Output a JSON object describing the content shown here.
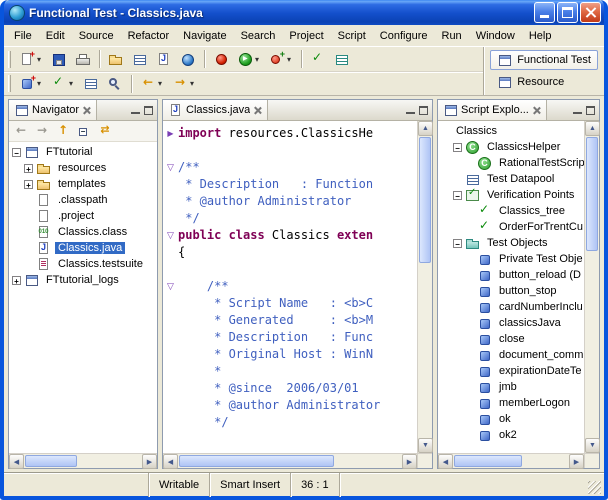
{
  "window": {
    "title": "Functional Test - Classics.java"
  },
  "menubar": {
    "items": [
      "File",
      "Edit",
      "Source",
      "Refactor",
      "Navigate",
      "Search",
      "Project",
      "Script",
      "Configure",
      "Run",
      "Window",
      "Help"
    ]
  },
  "toolbar": {
    "row1": [
      {
        "icon": "new-script-icon",
        "chevron": true
      },
      {
        "icon": "save-icon"
      },
      {
        "icon": "print-icon"
      },
      "sep",
      {
        "icon": "new-folder-icon"
      },
      {
        "icon": "new-datapool-icon"
      },
      {
        "icon": "new-java-icon"
      },
      {
        "icon": "globe-icon"
      },
      "sep",
      {
        "icon": "record-icon"
      },
      {
        "icon": "run-script-icon",
        "chevron": true
      },
      {
        "icon": "insert-recording-icon",
        "chevron": true
      },
      "sep",
      {
        "icon": "verification-point-icon"
      },
      {
        "icon": "object-map-icon"
      }
    ],
    "row2": [
      {
        "icon": "insert-object-icon",
        "chevron": true
      },
      {
        "icon": "insert-vp-icon",
        "chevron": true
      },
      {
        "icon": "datapool-icon"
      },
      {
        "icon": "find-object-icon"
      },
      "sep",
      {
        "icon": "back-icon",
        "chevron": true
      },
      {
        "icon": "forward-icon",
        "chevron": true
      }
    ],
    "perspectives": [
      {
        "label": "Functional Test",
        "selected": true
      },
      {
        "label": "Resource",
        "selected": false
      }
    ]
  },
  "navigator": {
    "title": "Navigator",
    "toolbar": [
      "back-icon",
      "forward-icon",
      "up-icon",
      "collapse-all-icon",
      "link-editor-icon"
    ],
    "tree": [
      {
        "label": "FTtutorial",
        "level": 0,
        "expander": "minus",
        "icon": "project-icon"
      },
      {
        "label": "resources",
        "level": 1,
        "expander": "plus",
        "icon": "folder-icon"
      },
      {
        "label": "templates",
        "level": 1,
        "expander": "plus",
        "icon": "folder-icon"
      },
      {
        "label": ".classpath",
        "level": 1,
        "icon": "file-icon"
      },
      {
        "label": ".project",
        "level": 1,
        "icon": "file-icon"
      },
      {
        "label": "Classics.class",
        "level": 1,
        "icon": "class-file-icon"
      },
      {
        "label": "Classics.java",
        "level": 1,
        "icon": "java-file-icon",
        "selected": true
      },
      {
        "label": "Classics.testsuite",
        "level": 1,
        "icon": "testsuite-icon"
      },
      {
        "label": "FTtutorial_logs",
        "level": 0,
        "expander": "plus",
        "icon": "project-icon"
      }
    ]
  },
  "editor": {
    "tab": "Classics.java",
    "lines": [
      {
        "fold": "closed",
        "segs": [
          {
            "c": "kw",
            "t": "import"
          },
          {
            "c": "pl",
            "t": " resources.ClassicsHe"
          }
        ]
      },
      {
        "segs": []
      },
      {
        "fold": "open",
        "segs": [
          {
            "c": "cm",
            "t": "/**"
          }
        ]
      },
      {
        "segs": [
          {
            "c": "cm",
            "t": " * Description   : Function"
          }
        ]
      },
      {
        "segs": [
          {
            "c": "cm",
            "t": " * @author Administrator"
          }
        ]
      },
      {
        "segs": [
          {
            "c": "cm",
            "t": " */"
          }
        ]
      },
      {
        "fold": "open",
        "segs": [
          {
            "c": "kw",
            "t": "public class"
          },
          {
            "c": "pl",
            "t": " Classics "
          },
          {
            "c": "kw",
            "t": "exten"
          }
        ]
      },
      {
        "segs": [
          {
            "c": "pl",
            "t": "{"
          }
        ]
      },
      {
        "segs": []
      },
      {
        "fold": "open",
        "segs": [
          {
            "c": "cm",
            "t": "    /**"
          }
        ]
      },
      {
        "segs": [
          {
            "c": "cm",
            "t": "     * Script Name   : <b>C"
          }
        ]
      },
      {
        "segs": [
          {
            "c": "cm",
            "t": "     * Generated     : <b>M"
          }
        ]
      },
      {
        "segs": [
          {
            "c": "cm",
            "t": "     * Description   : Func"
          }
        ]
      },
      {
        "segs": [
          {
            "c": "cm",
            "t": "     * Original Host : WinN"
          }
        ]
      },
      {
        "segs": [
          {
            "c": "cm",
            "t": "     *"
          }
        ]
      },
      {
        "segs": [
          {
            "c": "cm",
            "t": "     * @since  2006/03/01"
          }
        ]
      },
      {
        "segs": [
          {
            "c": "cm",
            "t": "     * @author Administrator"
          }
        ]
      },
      {
        "segs": [
          {
            "c": "cm",
            "t": "     */"
          }
        ]
      }
    ]
  },
  "script_explorer": {
    "title": "Script Explo...",
    "tree": [
      {
        "label": "Classics",
        "level": 0
      },
      {
        "label": "ClassicsHelper",
        "level": 1,
        "expander": "minus",
        "icon": "helper-icon"
      },
      {
        "label": "RationalTestScrip",
        "level": 2,
        "icon": "helper-icon"
      },
      {
        "label": "Test Datapool",
        "level": 1,
        "icon": "datapool-icon"
      },
      {
        "label": "Verification Points",
        "level": 1,
        "expander": "minus",
        "icon": "vp-folder-icon"
      },
      {
        "label": "Classics_tree",
        "level": 2,
        "icon": "vp-icon"
      },
      {
        "label": "OrderForTrentCu",
        "level": 2,
        "icon": "vp-icon"
      },
      {
        "label": "Test Objects",
        "level": 1,
        "expander": "minus",
        "icon": "to-folder-icon"
      },
      {
        "label": "Private Test Obje",
        "level": 2,
        "icon": "object-icon"
      },
      {
        "label": "button_reload (D",
        "level": 2,
        "icon": "object-icon"
      },
      {
        "label": "button_stop",
        "level": 2,
        "icon": "object-icon"
      },
      {
        "label": "cardNumberInclu",
        "level": 2,
        "icon": "object-icon"
      },
      {
        "label": "classicsJava",
        "level": 2,
        "icon": "object-icon"
      },
      {
        "label": "close",
        "level": 2,
        "icon": "object-icon"
      },
      {
        "label": "document_comm",
        "level": 2,
        "icon": "object-icon"
      },
      {
        "label": "expirationDateTe",
        "level": 2,
        "icon": "object-icon"
      },
      {
        "label": "jmb",
        "level": 2,
        "icon": "object-icon"
      },
      {
        "label": "memberLogon",
        "level": 2,
        "icon": "object-icon"
      },
      {
        "label": "ok",
        "level": 2,
        "icon": "object-icon"
      },
      {
        "label": "ok2",
        "level": 2,
        "icon": "object-icon"
      }
    ]
  },
  "statusbar": {
    "writable": "Writable",
    "insert_mode": "Smart Insert",
    "cursor_position": "36 : 1"
  }
}
